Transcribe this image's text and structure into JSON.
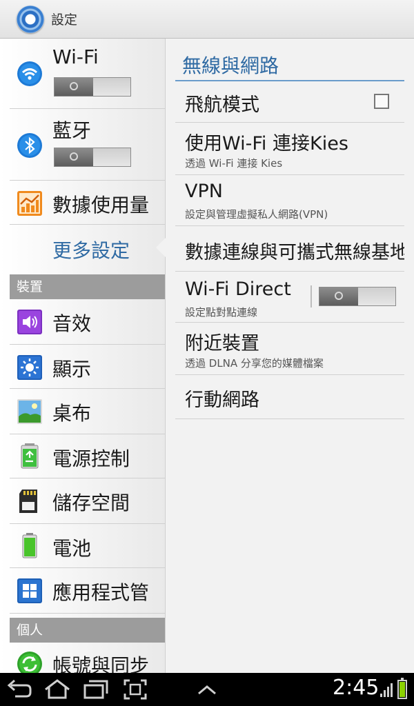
{
  "header": {
    "title": "設定",
    "icon": "settings-gear-icon"
  },
  "left_nav": {
    "wifi": {
      "label": "Wi-Fi",
      "icon": "wifi-icon",
      "toggle_on": false
    },
    "bluetooth": {
      "label": "藍牙",
      "icon": "bluetooth-icon",
      "toggle_on": false
    },
    "data_usage": {
      "label": "數據使用量",
      "icon": "data-usage-icon"
    },
    "more_settings": {
      "label": "更多設定",
      "selected": true
    },
    "section_device": "裝置",
    "sound": {
      "label": "音效",
      "icon": "sound-icon"
    },
    "display": {
      "label": "顯示",
      "icon": "display-icon"
    },
    "wallpaper": {
      "label": "桌布",
      "icon": "wallpaper-icon"
    },
    "power": {
      "label": "電源控制",
      "icon": "power-saving-icon"
    },
    "storage": {
      "label": "儲存空間",
      "icon": "storage-icon"
    },
    "battery": {
      "label": "電池",
      "icon": "battery-icon"
    },
    "apps": {
      "label": "應用程式管",
      "icon": "apps-icon"
    },
    "section_personal": "個人",
    "accounts": {
      "label": "帳號與同步",
      "icon": "sync-icon"
    }
  },
  "right_pane": {
    "title": "無線與網路",
    "items": [
      {
        "title": "飛航模式",
        "subtitle": "",
        "control": "checkbox",
        "checked": false
      },
      {
        "title": "使用Wi-Fi 連接Kies",
        "subtitle": "透過 Wi-Fi 連接 Kies"
      },
      {
        "title": "VPN",
        "subtitle": "設定與管理虛擬私人網路(VPN)"
      },
      {
        "title": "數據連線與可攜式無線基地台",
        "subtitle": ""
      },
      {
        "title": "Wi-Fi Direct",
        "subtitle": "設定點對點連線",
        "control": "toggle",
        "toggle_on": false
      },
      {
        "title": "附近裝置",
        "subtitle": "透過 DLNA 分享您的媒體檔案"
      },
      {
        "title": "行動網路",
        "subtitle": ""
      }
    ]
  },
  "status_bar": {
    "time": "2:45",
    "signal_icon": "signal-icon",
    "battery_icon": "battery-full-icon"
  },
  "nav_buttons": [
    "back-icon",
    "home-icon",
    "recent-apps-icon",
    "screenshot-icon",
    "up-arrow-icon"
  ],
  "colors": {
    "accent": "#2f6aa3",
    "section_header": "#9c9c9c",
    "battery_fill": "#8bd100"
  }
}
